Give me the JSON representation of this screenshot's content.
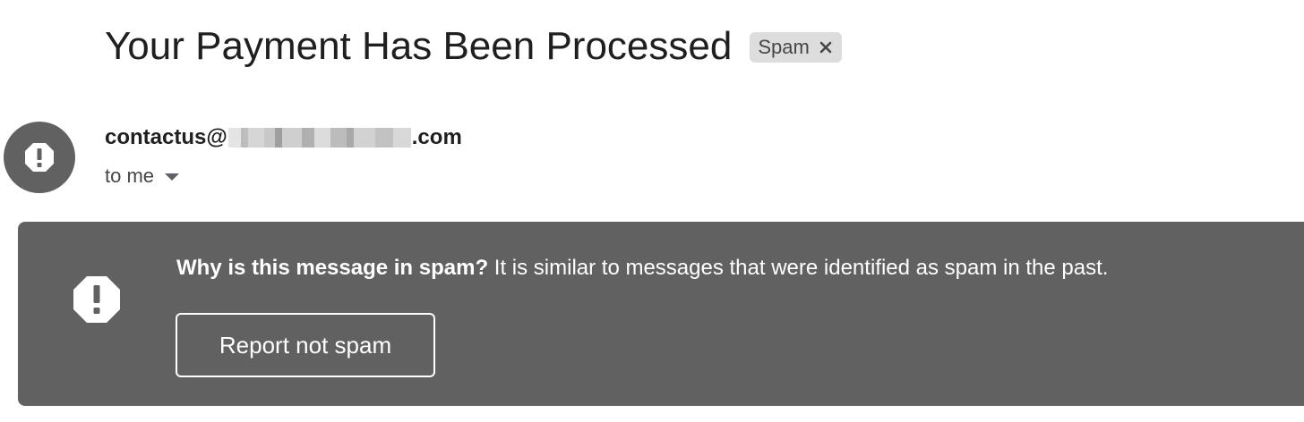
{
  "email": {
    "subject": "Your Payment Has Been Processed",
    "label_chip": {
      "label": "Spam",
      "close_icon": "close-icon"
    },
    "sender": {
      "avatar_icon": "warning-octagon-icon",
      "address_prefix": "contactus@",
      "address_suffix": ".com"
    },
    "recipient": {
      "label": "to me",
      "toggle_icon": "chevron-down-icon"
    }
  },
  "spam_banner": {
    "icon": "warning-octagon-icon",
    "heading": "Why is this message in spam?",
    "explanation": " It is similar to messages that were identified as spam in the past.",
    "report_button_label": "Report not spam",
    "background_color": "#616161"
  }
}
